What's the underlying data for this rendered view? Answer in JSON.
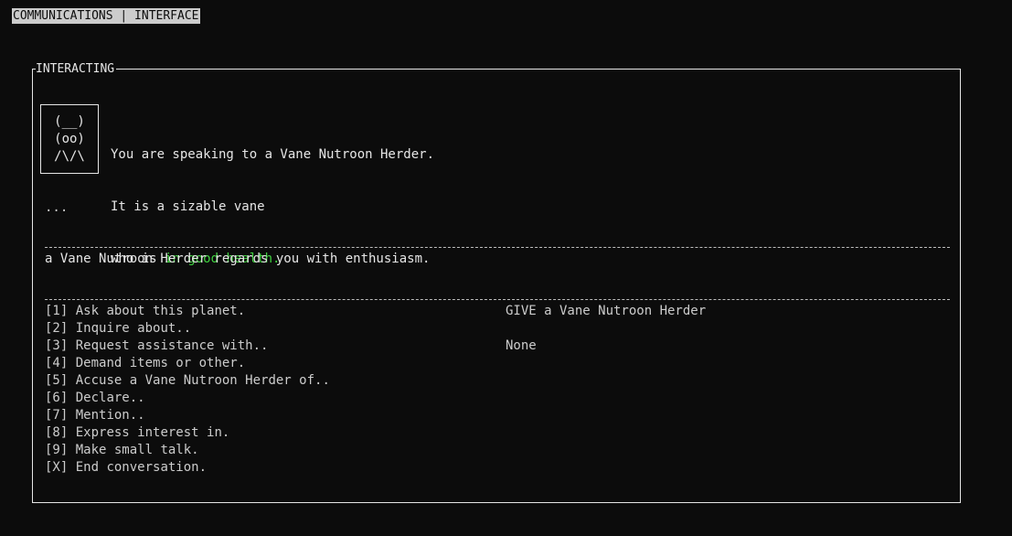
{
  "header": {
    "title": "COMMUNICATIONS | INTERFACE"
  },
  "panel": {
    "title": "INTERACTING",
    "portrait": [
      "(__)",
      "(oo)",
      "/\\/\\"
    ],
    "description": {
      "line1": "You are speaking to a Vane Nutroon Herder.",
      "line2": "It is a sizable vane",
      "line3_prefix": "who is ",
      "health": "in good health."
    },
    "ellipsis": "...",
    "regard": "a Vane Nutroon Herder regards you with enthusiasm."
  },
  "options": [
    {
      "key": "[1]",
      "label": "Ask about this planet."
    },
    {
      "key": "[2]",
      "label": "Inquire about.."
    },
    {
      "key": "[3]",
      "label": "Request assistance with.."
    },
    {
      "key": "[4]",
      "label": "Demand items or other."
    },
    {
      "key": "[5]",
      "label": "Accuse a Vane Nutroon Herder of.."
    },
    {
      "key": "[6]",
      "label": "Declare.."
    },
    {
      "key": "[7]",
      "label": "Mention.."
    },
    {
      "key": "[8]",
      "label": "Express interest in."
    },
    {
      "key": "[9]",
      "label": "Make small talk."
    },
    {
      "key": "[X]",
      "label": "End conversation."
    }
  ],
  "give": {
    "label": "GIVE a Vane Nutroon Herder",
    "value": "None"
  },
  "colors": {
    "background": "#0c0c0c",
    "text": "#cccccc",
    "health": "#3fd13f"
  }
}
